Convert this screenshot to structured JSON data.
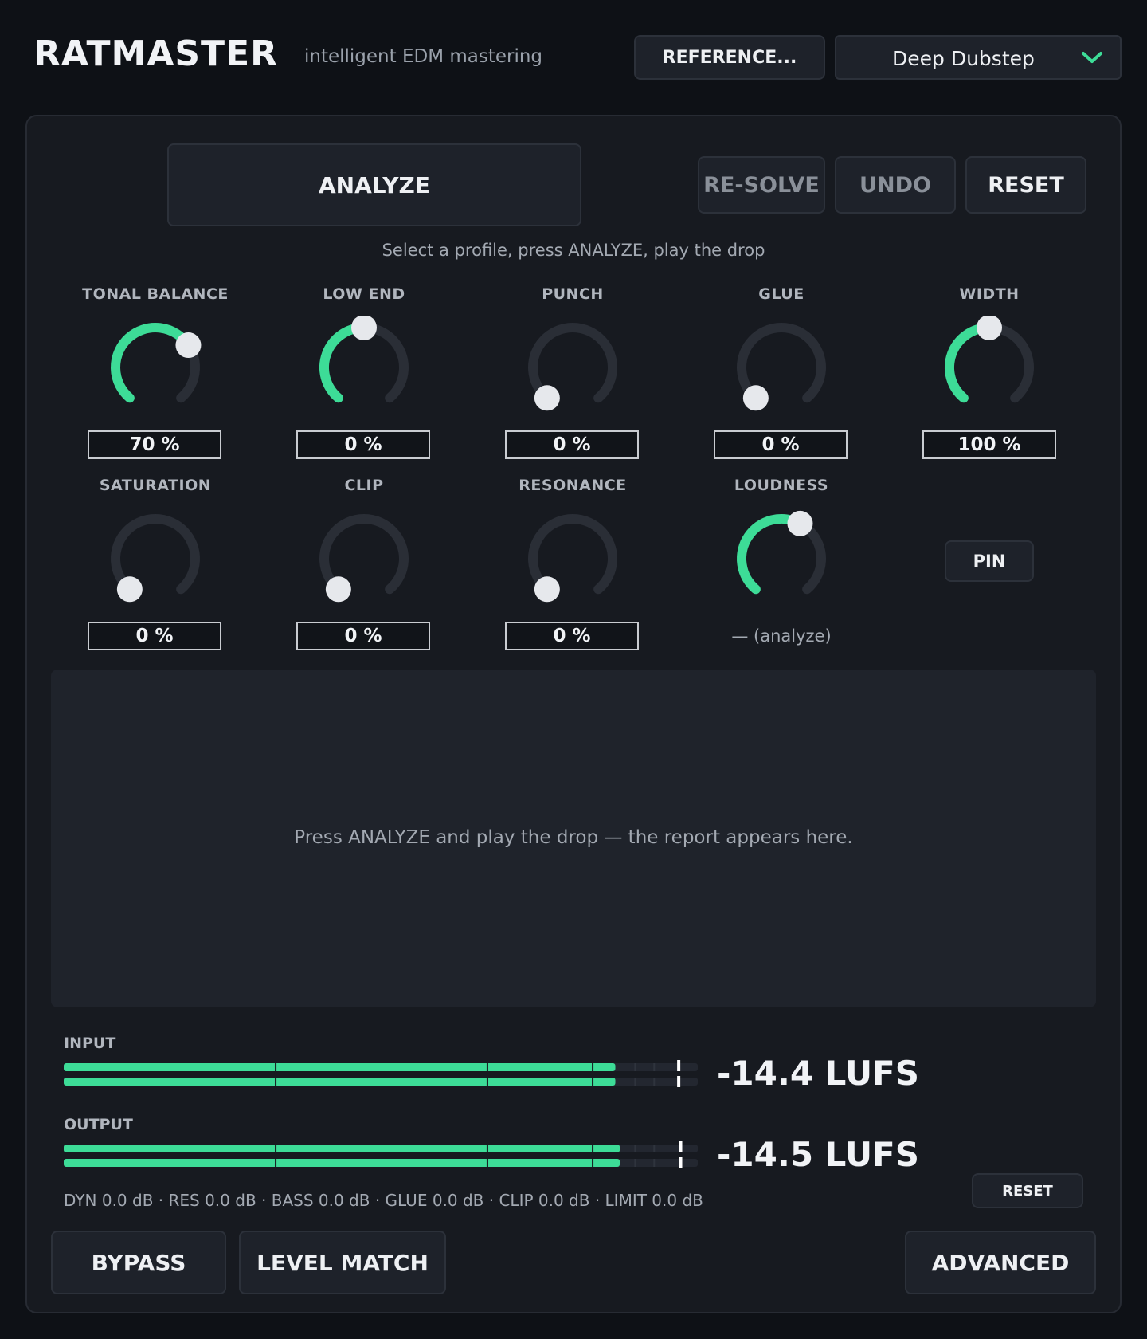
{
  "header": {
    "title": "RATMASTER",
    "subtitle": "intelligent EDM mastering",
    "reference_label": "REFERENCE...",
    "preset_value": "Deep Dubstep"
  },
  "actions": {
    "analyze": "ANALYZE",
    "resolve": "RE-SOLVE",
    "undo": "UNDO",
    "reset": "RESET"
  },
  "hint": "Select a profile, press ANALYZE, play the drop",
  "knobs": [
    {
      "label": "TONAL BALANCE",
      "value": "70 %",
      "amount": 0.7
    },
    {
      "label": "LOW END",
      "value": "0 %",
      "amount": 0.5
    },
    {
      "label": "PUNCH",
      "value": "0 %",
      "amount": 0.0
    },
    {
      "label": "GLUE",
      "value": "0 %",
      "amount": 0.0
    },
    {
      "label": "WIDTH",
      "value": "100 %",
      "amount": 0.5
    },
    {
      "label": "SATURATION",
      "value": "0 %",
      "amount": 0.0
    },
    {
      "label": "CLIP",
      "value": "0 %",
      "amount": 0.0
    },
    {
      "label": "RESONANCE",
      "value": "0 %",
      "amount": 0.0
    },
    {
      "label": "LOUDNESS",
      "value": "— (analyze)",
      "amount": 0.6
    }
  ],
  "pin_label": "PIN",
  "report_message": "Press ANALYZE and play the drop — the report appears here.",
  "meters": {
    "input": {
      "label": "INPUT",
      "reading": "-14.4 LUFS",
      "fill": 0.87,
      "peak": 0.97
    },
    "output": {
      "label": "OUTPUT",
      "reading": "-14.5 LUFS",
      "fill": 0.877,
      "peak": 0.973
    }
  },
  "stats": "DYN 0.0 dB  ·  RES 0.0 dB  ·  BASS 0.0 dB  ·  GLUE 0.0 dB  ·  CLIP 0.0 dB  ·  LIMIT 0.0 dB",
  "meter_reset": "RESET",
  "footer": {
    "bypass": "BYPASS",
    "level_match": "LEVEL MATCH",
    "advanced": "ADVANCED"
  },
  "colors": {
    "accent": "#3ddc97",
    "track": "#2a2e36",
    "handle": "#e6e8ec"
  },
  "icons": {
    "preset_dropdown": "chevron-down-icon",
    "knob_handle": "knob-handle"
  }
}
